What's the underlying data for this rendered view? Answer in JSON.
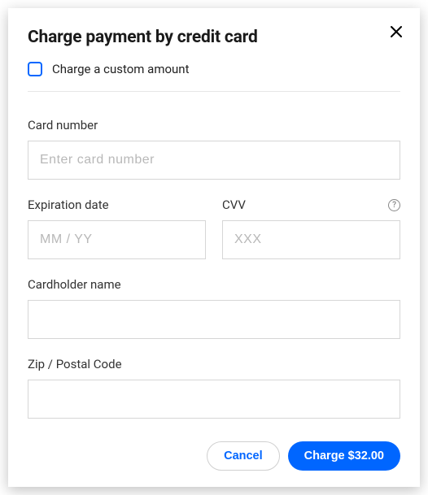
{
  "modal": {
    "title": "Charge payment by credit card",
    "custom_amount_label": "Charge a custom amount"
  },
  "form": {
    "card_number": {
      "label": "Card number",
      "placeholder": "Enter card number",
      "value": ""
    },
    "expiration": {
      "label": "Expiration date",
      "placeholder": "MM / YY",
      "value": ""
    },
    "cvv": {
      "label": "CVV",
      "placeholder": "XXX",
      "value": "",
      "help": "?"
    },
    "cardholder": {
      "label": "Cardholder name",
      "value": ""
    },
    "zip": {
      "label": "Zip / Postal Code",
      "value": ""
    }
  },
  "footer": {
    "cancel_label": "Cancel",
    "charge_label": "Charge $32.00"
  }
}
